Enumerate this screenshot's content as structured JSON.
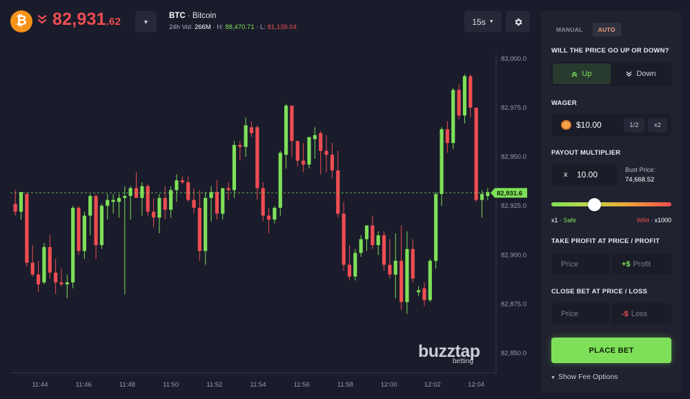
{
  "header": {
    "coin_icon_glyph": "₿",
    "price_main": "82,931",
    "price_decimal": ".62",
    "symbol": "BTC",
    "name": "· Bitcoin",
    "vol_label": "24h Vol:",
    "vol_value": "266M",
    "high_label": "· H:",
    "high_value": "88,470.71",
    "low_label": "· L:",
    "low_value": "81,139.04",
    "timeframe": "15s"
  },
  "colors": {
    "up": "#7ee058",
    "down": "#ef4d52",
    "background": "#1a1c2b",
    "panel": "#20222f",
    "accent": "#f0a27a"
  },
  "icons": {
    "coin": "bitcoin-icon",
    "trend": "double-chevron-down-icon",
    "dropdown": "caret-down-icon",
    "settings": "gear-icon",
    "up": "double-chevron-up-icon",
    "down": "double-chevron-down-icon",
    "wager": "coin-icon"
  },
  "watermark": {
    "main": "buzztap",
    "sub": "betting"
  },
  "panel": {
    "tabs": [
      "MANUAL",
      "AUTO"
    ],
    "active_tab": "AUTO",
    "direction_title": "WILL THE PRICE GO UP OR DOWN?",
    "up_label": "Up",
    "down_label": "Down",
    "wager_title": "WAGER",
    "wager_value": "$10.00",
    "half_label": "1/2",
    "double_label": "x2",
    "payout_title": "PAYOUT MULTIPLIER",
    "multiplier_prefix": "x",
    "multiplier_value": "10.00",
    "bust_label": "Bust Price:",
    "bust_value": "74,668.52",
    "slider_fraction": 0.36,
    "slider_left_value": "x1",
    "slider_left_label": "· Safe",
    "slider_right_label": "Wild",
    "slider_right_value": "· x1000",
    "take_profit_title": "TAKE PROFIT AT PRICE / PROFIT",
    "tp_price_placeholder": "Price",
    "tp_profit_prefix": "+$",
    "tp_profit_placeholder": "Profit",
    "close_title": "CLOSE BET AT PRICE / LOSS",
    "cl_price_placeholder": "Price",
    "cl_loss_prefix": "-$",
    "cl_loss_placeholder": "Loss",
    "place_bet": "PLACE BET",
    "fee_options": "Show Fee Options"
  },
  "chart_data": {
    "type": "candlestick",
    "x_ticks": [
      "11:44",
      "11:46",
      "11:48",
      "11:50",
      "11:52",
      "11:54",
      "11:56",
      "11:58",
      "12:00",
      "12:02",
      "12:04"
    ],
    "y_ticks": [
      "83,000.0",
      "82,975.0",
      "82,950.0",
      "82,925.0",
      "82,900.0",
      "82,875.0",
      "82,850.0"
    ],
    "ylim": [
      82840,
      83008
    ],
    "current_price": 82931.6,
    "current_price_label": "82,931.6",
    "candles": [
      {
        "o": 82926,
        "h": 82933,
        "l": 82920,
        "c": 82922
      },
      {
        "o": 82922,
        "h": 82932,
        "l": 82918,
        "c": 82932
      },
      {
        "o": 82931,
        "h": 82932,
        "l": 82894,
        "c": 82896
      },
      {
        "o": 82896,
        "h": 82905,
        "l": 82889,
        "c": 82890
      },
      {
        "o": 82890,
        "h": 82897,
        "l": 82881,
        "c": 82885
      },
      {
        "o": 82886,
        "h": 82906,
        "l": 82885,
        "c": 82904
      },
      {
        "o": 82904,
        "h": 82910,
        "l": 82888,
        "c": 82891
      },
      {
        "o": 82891,
        "h": 82898,
        "l": 82880,
        "c": 82886
      },
      {
        "o": 82886,
        "h": 82893,
        "l": 82884,
        "c": 82885
      },
      {
        "o": 82885,
        "h": 82890,
        "l": 82878,
        "c": 82886
      },
      {
        "o": 82886,
        "h": 82925,
        "l": 82883,
        "c": 82924
      },
      {
        "o": 82924,
        "h": 82925,
        "l": 82900,
        "c": 82902
      },
      {
        "o": 82902,
        "h": 82922,
        "l": 82898,
        "c": 82920
      },
      {
        "o": 82920,
        "h": 82931,
        "l": 82910,
        "c": 82930
      },
      {
        "o": 82930,
        "h": 82931,
        "l": 82898,
        "c": 82905
      },
      {
        "o": 82905,
        "h": 82926,
        "l": 82903,
        "c": 82925
      },
      {
        "o": 82925,
        "h": 82931,
        "l": 82918,
        "c": 82928
      },
      {
        "o": 82927,
        "h": 82931,
        "l": 82921,
        "c": 82928
      },
      {
        "o": 82927,
        "h": 82931,
        "l": 82919,
        "c": 82929
      },
      {
        "o": 82929,
        "h": 82935,
        "l": 82880,
        "c": 82930
      },
      {
        "o": 82930,
        "h": 82935,
        "l": 82918,
        "c": 82934
      },
      {
        "o": 82934,
        "h": 82942,
        "l": 82929,
        "c": 82929
      },
      {
        "o": 82929,
        "h": 82937,
        "l": 82920,
        "c": 82935
      },
      {
        "o": 82935,
        "h": 82936,
        "l": 82920,
        "c": 82922
      },
      {
        "o": 82922,
        "h": 82929,
        "l": 82914,
        "c": 82919
      },
      {
        "o": 82919,
        "h": 82931,
        "l": 82911,
        "c": 82929
      },
      {
        "o": 82929,
        "h": 82935,
        "l": 82918,
        "c": 82923
      },
      {
        "o": 82923,
        "h": 82935,
        "l": 82919,
        "c": 82933
      },
      {
        "o": 82933,
        "h": 82941,
        "l": 82927,
        "c": 82938
      },
      {
        "o": 82938,
        "h": 82940,
        "l": 82936,
        "c": 82937
      },
      {
        "o": 82937,
        "h": 82940,
        "l": 82927,
        "c": 82928
      },
      {
        "o": 82928,
        "h": 82934,
        "l": 82921,
        "c": 82924
      },
      {
        "o": 82924,
        "h": 82933,
        "l": 82897,
        "c": 82902
      },
      {
        "o": 82902,
        "h": 82932,
        "l": 82895,
        "c": 82929
      },
      {
        "o": 82929,
        "h": 82935,
        "l": 82917,
        "c": 82932
      },
      {
        "o": 82932,
        "h": 82938,
        "l": 82918,
        "c": 82921
      },
      {
        "o": 82921,
        "h": 82934,
        "l": 82918,
        "c": 82934
      },
      {
        "o": 82934,
        "h": 82937,
        "l": 82928,
        "c": 82933
      },
      {
        "o": 82933,
        "h": 82958,
        "l": 82929,
        "c": 82956
      },
      {
        "o": 82956,
        "h": 82958,
        "l": 82948,
        "c": 82955
      },
      {
        "o": 82955,
        "h": 82970,
        "l": 82950,
        "c": 82966
      },
      {
        "o": 82965,
        "h": 82968,
        "l": 82960,
        "c": 82962
      },
      {
        "o": 82965,
        "h": 82966,
        "l": 82928,
        "c": 82934
      },
      {
        "o": 82934,
        "h": 82937,
        "l": 82917,
        "c": 82920
      },
      {
        "o": 82920,
        "h": 82924,
        "l": 82911,
        "c": 82918
      },
      {
        "o": 82918,
        "h": 82925,
        "l": 82916,
        "c": 82924
      },
      {
        "o": 82924,
        "h": 82953,
        "l": 82920,
        "c": 82952
      },
      {
        "o": 82951,
        "h": 82977,
        "l": 82944,
        "c": 82976
      },
      {
        "o": 82976,
        "h": 82976,
        "l": 82950,
        "c": 82958
      },
      {
        "o": 82958,
        "h": 82953,
        "l": 82945,
        "c": 82948
      },
      {
        "o": 82948,
        "h": 82957,
        "l": 82942,
        "c": 82946
      },
      {
        "o": 82946,
        "h": 82960,
        "l": 82944,
        "c": 82960
      },
      {
        "o": 82959,
        "h": 82965,
        "l": 82949,
        "c": 82961
      },
      {
        "o": 82962,
        "h": 82963,
        "l": 82941,
        "c": 82953
      },
      {
        "o": 82953,
        "h": 82961,
        "l": 82942,
        "c": 82951
      },
      {
        "o": 82951,
        "h": 82957,
        "l": 82939,
        "c": 82943
      },
      {
        "o": 82943,
        "h": 82953,
        "l": 82919,
        "c": 82921
      },
      {
        "o": 82921,
        "h": 82927,
        "l": 82892,
        "c": 82895
      },
      {
        "o": 82895,
        "h": 82905,
        "l": 82887,
        "c": 82889
      },
      {
        "o": 82889,
        "h": 82903,
        "l": 82887,
        "c": 82901
      },
      {
        "o": 82901,
        "h": 82910,
        "l": 82899,
        "c": 82908
      },
      {
        "o": 82908,
        "h": 82915,
        "l": 82902,
        "c": 82915
      },
      {
        "o": 82915,
        "h": 82920,
        "l": 82903,
        "c": 82905
      },
      {
        "o": 82905,
        "h": 82912,
        "l": 82900,
        "c": 82910
      },
      {
        "o": 82910,
        "h": 82912,
        "l": 82892,
        "c": 82895
      },
      {
        "o": 82895,
        "h": 82908,
        "l": 82888,
        "c": 82890
      },
      {
        "o": 82890,
        "h": 82911,
        "l": 82878,
        "c": 82897
      },
      {
        "o": 82897,
        "h": 82915,
        "l": 82872,
        "c": 82876
      },
      {
        "o": 82876,
        "h": 82912,
        "l": 82870,
        "c": 82903
      },
      {
        "o": 82903,
        "h": 82908,
        "l": 82886,
        "c": 82888
      },
      {
        "o": 82881,
        "h": 82884,
        "l": 82879,
        "c": 82882
      },
      {
        "o": 82883,
        "h": 82886,
        "l": 82874,
        "c": 82877
      },
      {
        "o": 82877,
        "h": 82898,
        "l": 82876,
        "c": 82897
      },
      {
        "o": 82897,
        "h": 82932,
        "l": 82893,
        "c": 82931
      },
      {
        "o": 82931,
        "h": 82965,
        "l": 82925,
        "c": 82964
      },
      {
        "o": 82964,
        "h": 82968,
        "l": 82952,
        "c": 82957
      },
      {
        "o": 82957,
        "h": 82985,
        "l": 82954,
        "c": 82984
      },
      {
        "o": 82984,
        "h": 82987,
        "l": 82969,
        "c": 82971
      },
      {
        "o": 82971,
        "h": 82992,
        "l": 82967,
        "c": 82991
      },
      {
        "o": 82991,
        "h": 82992,
        "l": 82970,
        "c": 82975
      },
      {
        "o": 82975,
        "h": 82975,
        "l": 82927,
        "c": 82928
      },
      {
        "o": 82928,
        "h": 82933,
        "l": 82919,
        "c": 82931
      },
      {
        "o": 82930,
        "h": 82934,
        "l": 82928,
        "c": 82932
      }
    ]
  }
}
